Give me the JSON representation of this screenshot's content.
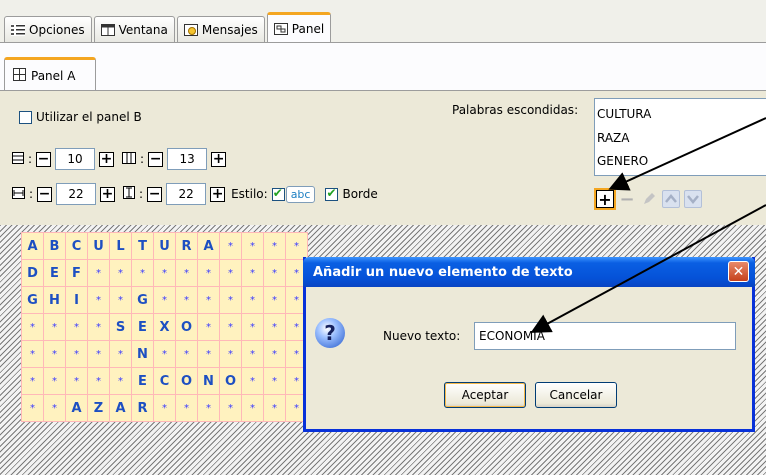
{
  "top_tabs": [
    {
      "label": "Opciones",
      "icon": "options-list-icon"
    },
    {
      "label": "Ventana",
      "icon": "window-icon"
    },
    {
      "label": "Mensajes",
      "icon": "messages-icon"
    },
    {
      "label": "Panel",
      "icon": "panel-icon"
    }
  ],
  "sub_tab": {
    "label": "Panel A",
    "icon": "grid-panel-icon"
  },
  "controls": {
    "use_panel_b": "Utilizar el panel B",
    "rows_value": "10",
    "cols_value": "13",
    "width_value": "22",
    "height_value": "22",
    "style_label": "Estilo:",
    "style_sample": "abc",
    "border_label": "Borde"
  },
  "hidden_words": {
    "label": "Palabras escondidas:",
    "items": [
      "CULTURA",
      "RAZA",
      "GENERO"
    ]
  },
  "grid": {
    "rows": [
      [
        "A",
        "B",
        "C",
        "U",
        "L",
        "T",
        "U",
        "R",
        "A",
        "*",
        "*",
        "*",
        "*"
      ],
      [
        "D",
        "E",
        "F",
        "*",
        "*",
        "*",
        "*",
        "*",
        "*",
        "*",
        "*",
        "*",
        "*"
      ],
      [
        "G",
        "H",
        "I",
        "*",
        "*",
        "G",
        "*",
        "*",
        "*",
        "*",
        "*",
        "*",
        "*"
      ],
      [
        "*",
        "*",
        "*",
        "*",
        "S",
        "E",
        "X",
        "O",
        "*",
        "*",
        "*",
        "*",
        "*"
      ],
      [
        "*",
        "*",
        "*",
        "*",
        "*",
        "N",
        "*",
        "*",
        "*",
        "*",
        "*",
        "*",
        "*"
      ],
      [
        "*",
        "*",
        "*",
        "*",
        "*",
        "E",
        "C",
        "O",
        "N",
        "O",
        "*",
        "*",
        "*"
      ],
      [
        "*",
        "*",
        "A",
        "Z",
        "A",
        "R",
        "*",
        "*",
        "*",
        "*",
        "*",
        "*",
        "*"
      ]
    ]
  },
  "dialog": {
    "title": "Añadir un nuevo elemento de texto",
    "label": "Nuevo texto:",
    "input_value": "ECONOMIA",
    "ok": "Aceptar",
    "cancel": "Cancelar"
  },
  "colors": {
    "accent_tab": "#f4a621",
    "title_bar": "#0552d8",
    "grid_letter": "#1d4fc2",
    "grid_bg": "#fff2bf"
  }
}
